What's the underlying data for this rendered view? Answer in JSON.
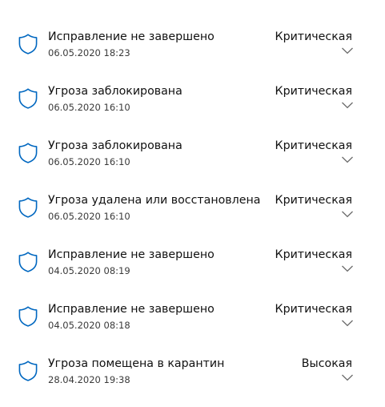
{
  "colors": {
    "shield_stroke": "#0067c0",
    "chevron": "#6b6b6b",
    "text_primary": "#111111",
    "text_secondary": "#3a3a3a"
  },
  "icons": {
    "item_icon": "shield-icon",
    "expand_icon": "chevron-down-icon"
  },
  "threats": [
    {
      "title": "Исправление не завершено",
      "date": "06.05.2020 18:23",
      "severity": "Критическая"
    },
    {
      "title": "Угроза заблокирована",
      "date": "06.05.2020 16:10",
      "severity": "Критическая"
    },
    {
      "title": "Угроза заблокирована",
      "date": "06.05.2020 16:10",
      "severity": "Критическая"
    },
    {
      "title": "Угроза удалена или восстановлена",
      "date": "06.05.2020 16:10",
      "severity": "Критическая"
    },
    {
      "title": "Исправление не завершено",
      "date": "04.05.2020 08:19",
      "severity": "Критическая"
    },
    {
      "title": "Исправление не завершено",
      "date": "04.05.2020 08:18",
      "severity": "Критическая"
    },
    {
      "title": "Угроза помещена в карантин",
      "date": "28.04.2020 19:38",
      "severity": "Высокая"
    }
  ]
}
